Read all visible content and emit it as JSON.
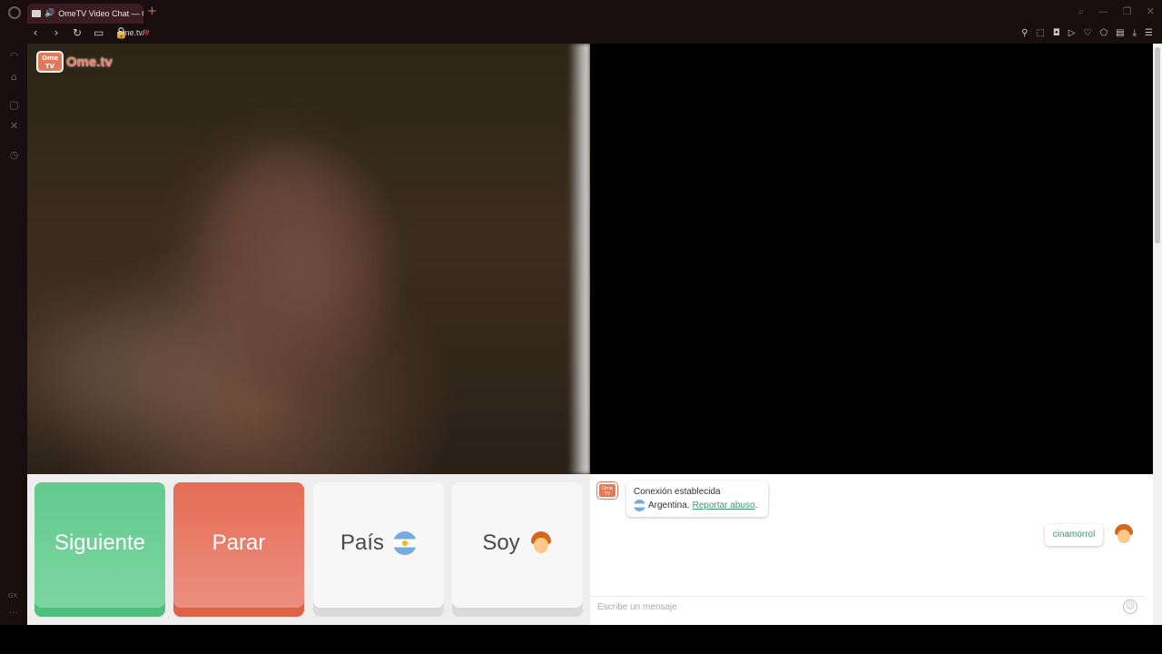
{
  "browser": {
    "tab_title": "OmeTV Video Chat — O",
    "new_tab_label": "+",
    "url_host": "ome.tv/",
    "url_hash": "#",
    "sidebar_label": "GX",
    "sidebar_more": "···"
  },
  "logo": {
    "badge_top": "Ome",
    "badge_bottom": "TV",
    "text": "Ome.tv",
    "brand_color": "#e8836a"
  },
  "controls": {
    "next_label": "Siguiente",
    "stop_label": "Parar",
    "country_label": "País",
    "country_flag": "argentina-flag-icon",
    "gender_label": "Soy",
    "gender_icon": "boy-avatar-icon",
    "next_color": "#62cb8d",
    "stop_color": "#e66c55"
  },
  "chat": {
    "system_title": "Conexión establecida",
    "country_name": "Argentina.",
    "report_link": "Reportar abuso",
    "report_suffix": ".",
    "user_message": "cinamorrol",
    "input_placeholder": "Escribe un mensaje",
    "link_color": "#3e9a6b"
  }
}
